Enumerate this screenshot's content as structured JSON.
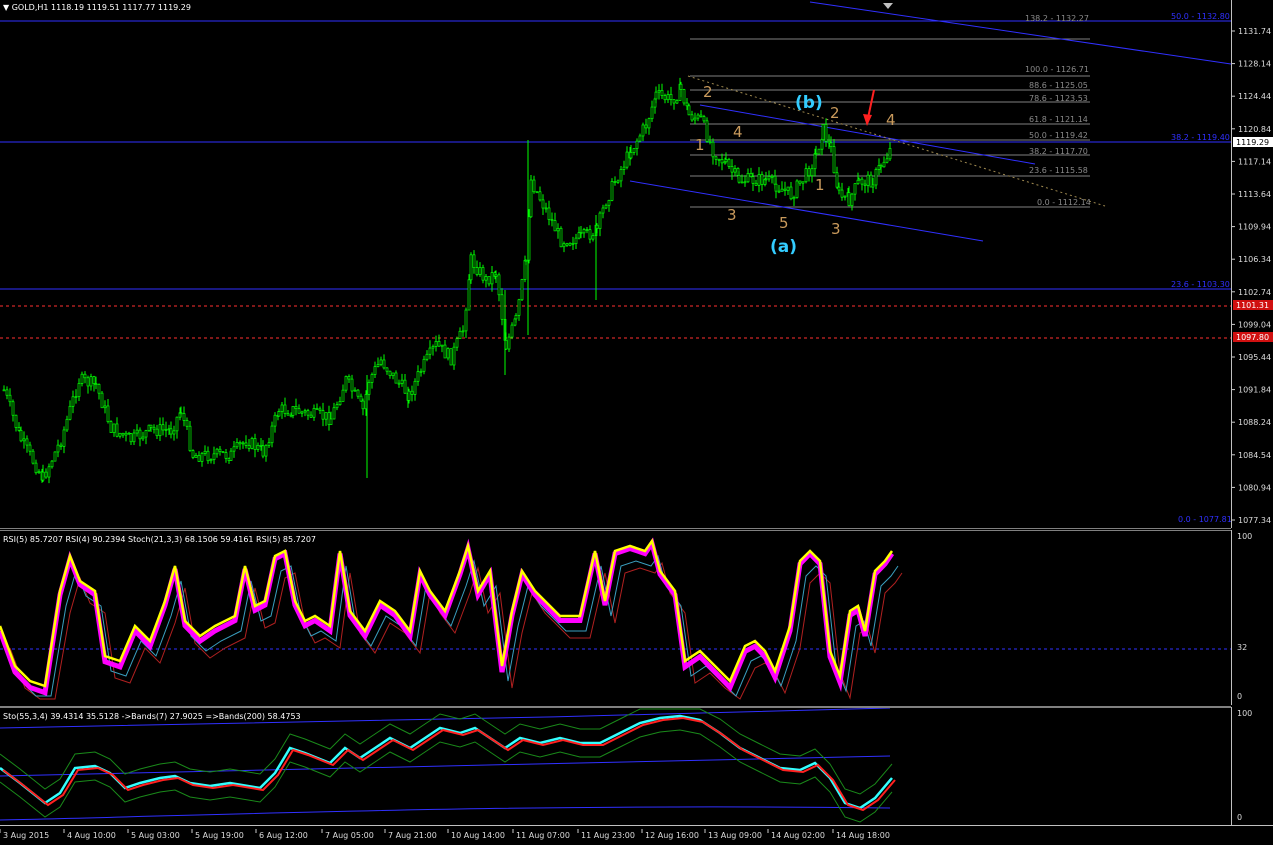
{
  "window": {
    "title": "GOLD,H1",
    "ohlc": "1118.19 1119.51 1117.77 1119.29",
    "current_price": "1119.29"
  },
  "colors": {
    "background": "#000000",
    "candle": "#00ff00",
    "trendline": "#3030ff",
    "fib": "#808080",
    "level_red": "#ff3030",
    "wave_label": "#c99a5c",
    "wave_cyan": "#33ccff",
    "rsi_yellow": "#ffff00",
    "rsi_magenta": "#ff00ff"
  },
  "price_axis": [
    "1131.74",
    "1128.14",
    "1124.44",
    "1120.84",
    "1117.14",
    "1113.64",
    "1109.94",
    "1106.34",
    "1102.74",
    "1099.04",
    "1095.44",
    "1091.84",
    "1088.24",
    "1084.54",
    "1080.94",
    "1077.34"
  ],
  "red_levels": [
    "1101.31",
    "1097.80"
  ],
  "fib_labels": [
    "138.2 - 1132.27",
    "100.0 - 1126.71",
    "88.6 - 1125.05",
    "78.6 - 1123.53",
    "61.8 - 1121.14",
    "50.0 - 1119.42",
    "38.2 - 1117.70",
    "23.6 - 1115.58",
    "0.0 - 1112.14"
  ],
  "big_fib_labels": [
    "50.0 - 1132.80",
    "38.2 - 1119.40",
    "23.6 - 1103.30",
    "0.0 - 1077.81"
  ],
  "wave_labels": {
    "b": "(b)",
    "a": "(a)",
    "w2": "2",
    "w1": "1",
    "w4": "4",
    "w3": "3",
    "w5": "5",
    "w2b": "2",
    "w1b": "1",
    "w3b": "3",
    "w4b": "4"
  },
  "rsi": {
    "label": "RSI(5) 85.7207  RSI(4) 90.2394  Stoch(21,3,3) 68.1506 59.4161  RSI(5) 85.7207",
    "axis": [
      "100",
      "32",
      "0"
    ]
  },
  "sto": {
    "label": "Sto(55,3,4) 39.4314 35.5128  ->Bands(7) 27.9025  =>Bands(200) 58.4753",
    "axis": [
      "100",
      "0"
    ]
  },
  "time_axis": [
    "3 Aug 2015",
    "4 Aug 10:00",
    "5 Aug 03:00",
    "5 Aug 19:00",
    "6 Aug 12:00",
    "7 Aug 05:00",
    "7 Aug 21:00",
    "10 Aug 14:00",
    "11 Aug 07:00",
    "11 Aug 23:00",
    "12 Aug 16:00",
    "13 Aug 09:00",
    "14 Aug 02:00",
    "14 Aug 18:00"
  ]
}
